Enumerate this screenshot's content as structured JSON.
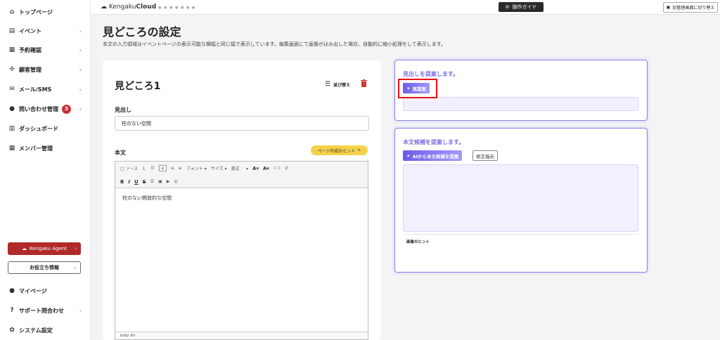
{
  "sidebar": {
    "items": [
      {
        "label": "トップページ",
        "icon": "home-icon",
        "glyph": "⌂",
        "chevron": false
      },
      {
        "label": "イベント",
        "icon": "document-icon",
        "glyph": "▤",
        "chevron": true
      },
      {
        "label": "予約確認",
        "icon": "calendar-icon",
        "glyph": "▦",
        "chevron": true
      },
      {
        "label": "顧客管理",
        "icon": "users-icon",
        "glyph": "✣",
        "chevron": true
      },
      {
        "label": "メール/SMS",
        "icon": "mail-icon",
        "glyph": "✉",
        "chevron": true
      },
      {
        "label": "問い合わせ管理",
        "icon": "chat-icon",
        "glyph": "●",
        "chevron": true,
        "badge": "3"
      },
      {
        "label": "ダッシュボード",
        "icon": "chart-icon",
        "glyph": "▥",
        "chevron": false
      },
      {
        "label": "メンバー管理",
        "icon": "grid-icon",
        "glyph": "▦",
        "chevron": false
      }
    ],
    "agent_button": "Kengaku Agent",
    "useful_info": "お役立ち情報",
    "bottom_items": [
      {
        "label": "マイページ",
        "icon": "person-icon",
        "glyph": "●",
        "chevron": false
      },
      {
        "label": "サポート問合わせ",
        "icon": "help-icon",
        "glyph": "?",
        "chevron": true
      },
      {
        "label": "システム設定",
        "icon": "gear-icon",
        "glyph": "✿",
        "chevron": false
      }
    ]
  },
  "topbar": {
    "logo_prefix": "Kengaku",
    "logo_bold": "Cloud",
    "guide_button": "操作ガイド",
    "old_admin_button": "旧管理画面に切り替え"
  },
  "page": {
    "title": "見どころの設定",
    "description": "本文の入力領域はイベントページの表示可能な横幅と同じ幅で表示しています。編集画面にて画像がはみ出した場合、自動的に縮小処理をして表示します。"
  },
  "editor_card": {
    "title": "見どころ1",
    "sort_label": "並び替え",
    "heading_label": "見出し",
    "heading_value": "柱のない空間",
    "body_label": "本文",
    "hint_button": "ページ作成のヒント",
    "toolbar": {
      "source": "ソース",
      "font": "フォント",
      "size": "サイズ",
      "format": "書式"
    },
    "body_text": "柱のない開放的な空間",
    "footer_path": "body  div"
  },
  "suggest_heading": {
    "title": "見出しを提案します。",
    "button": "再提案"
  },
  "suggest_body": {
    "title": "本文候補を提案します。",
    "ai_button": "AIから本文候補を提案",
    "fix_button": "修正指示",
    "image_hint": "画像のヒント"
  },
  "colors": {
    "accent_purple": "#7b6fe6",
    "agent_red": "#b02a2a",
    "hint_yellow": "#f5d24a",
    "highlight_red": "#e11111"
  }
}
